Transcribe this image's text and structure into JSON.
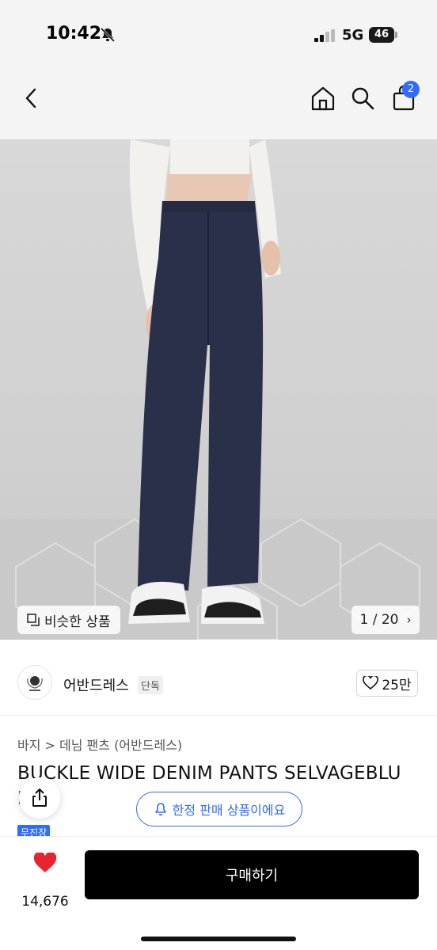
{
  "status_bar": {
    "time": "10:42",
    "network": "5G",
    "battery": "46"
  },
  "nav": {
    "cart_count": "2"
  },
  "hero": {
    "similar_label": "비슷한 상품",
    "counter": "1 / 20"
  },
  "brand": {
    "name": "어반드레스",
    "tag": "단독",
    "likes": "25만"
  },
  "product": {
    "breadcrumb": "바지 > 데님 팬츠 (어반드레스)",
    "title_line1": "BUCKLE WIDE DENIM PANTS SELVAGEBLU",
    "title_line2": "E",
    "badge": "무진장",
    "limited_label": "한정 판매 상품이에요"
  },
  "bottom": {
    "like_count": "14,676",
    "buy_label": "구매하기"
  },
  "colors": {
    "accent": "#2f6bff",
    "heart": "#e8252f",
    "buy": "#000000"
  }
}
